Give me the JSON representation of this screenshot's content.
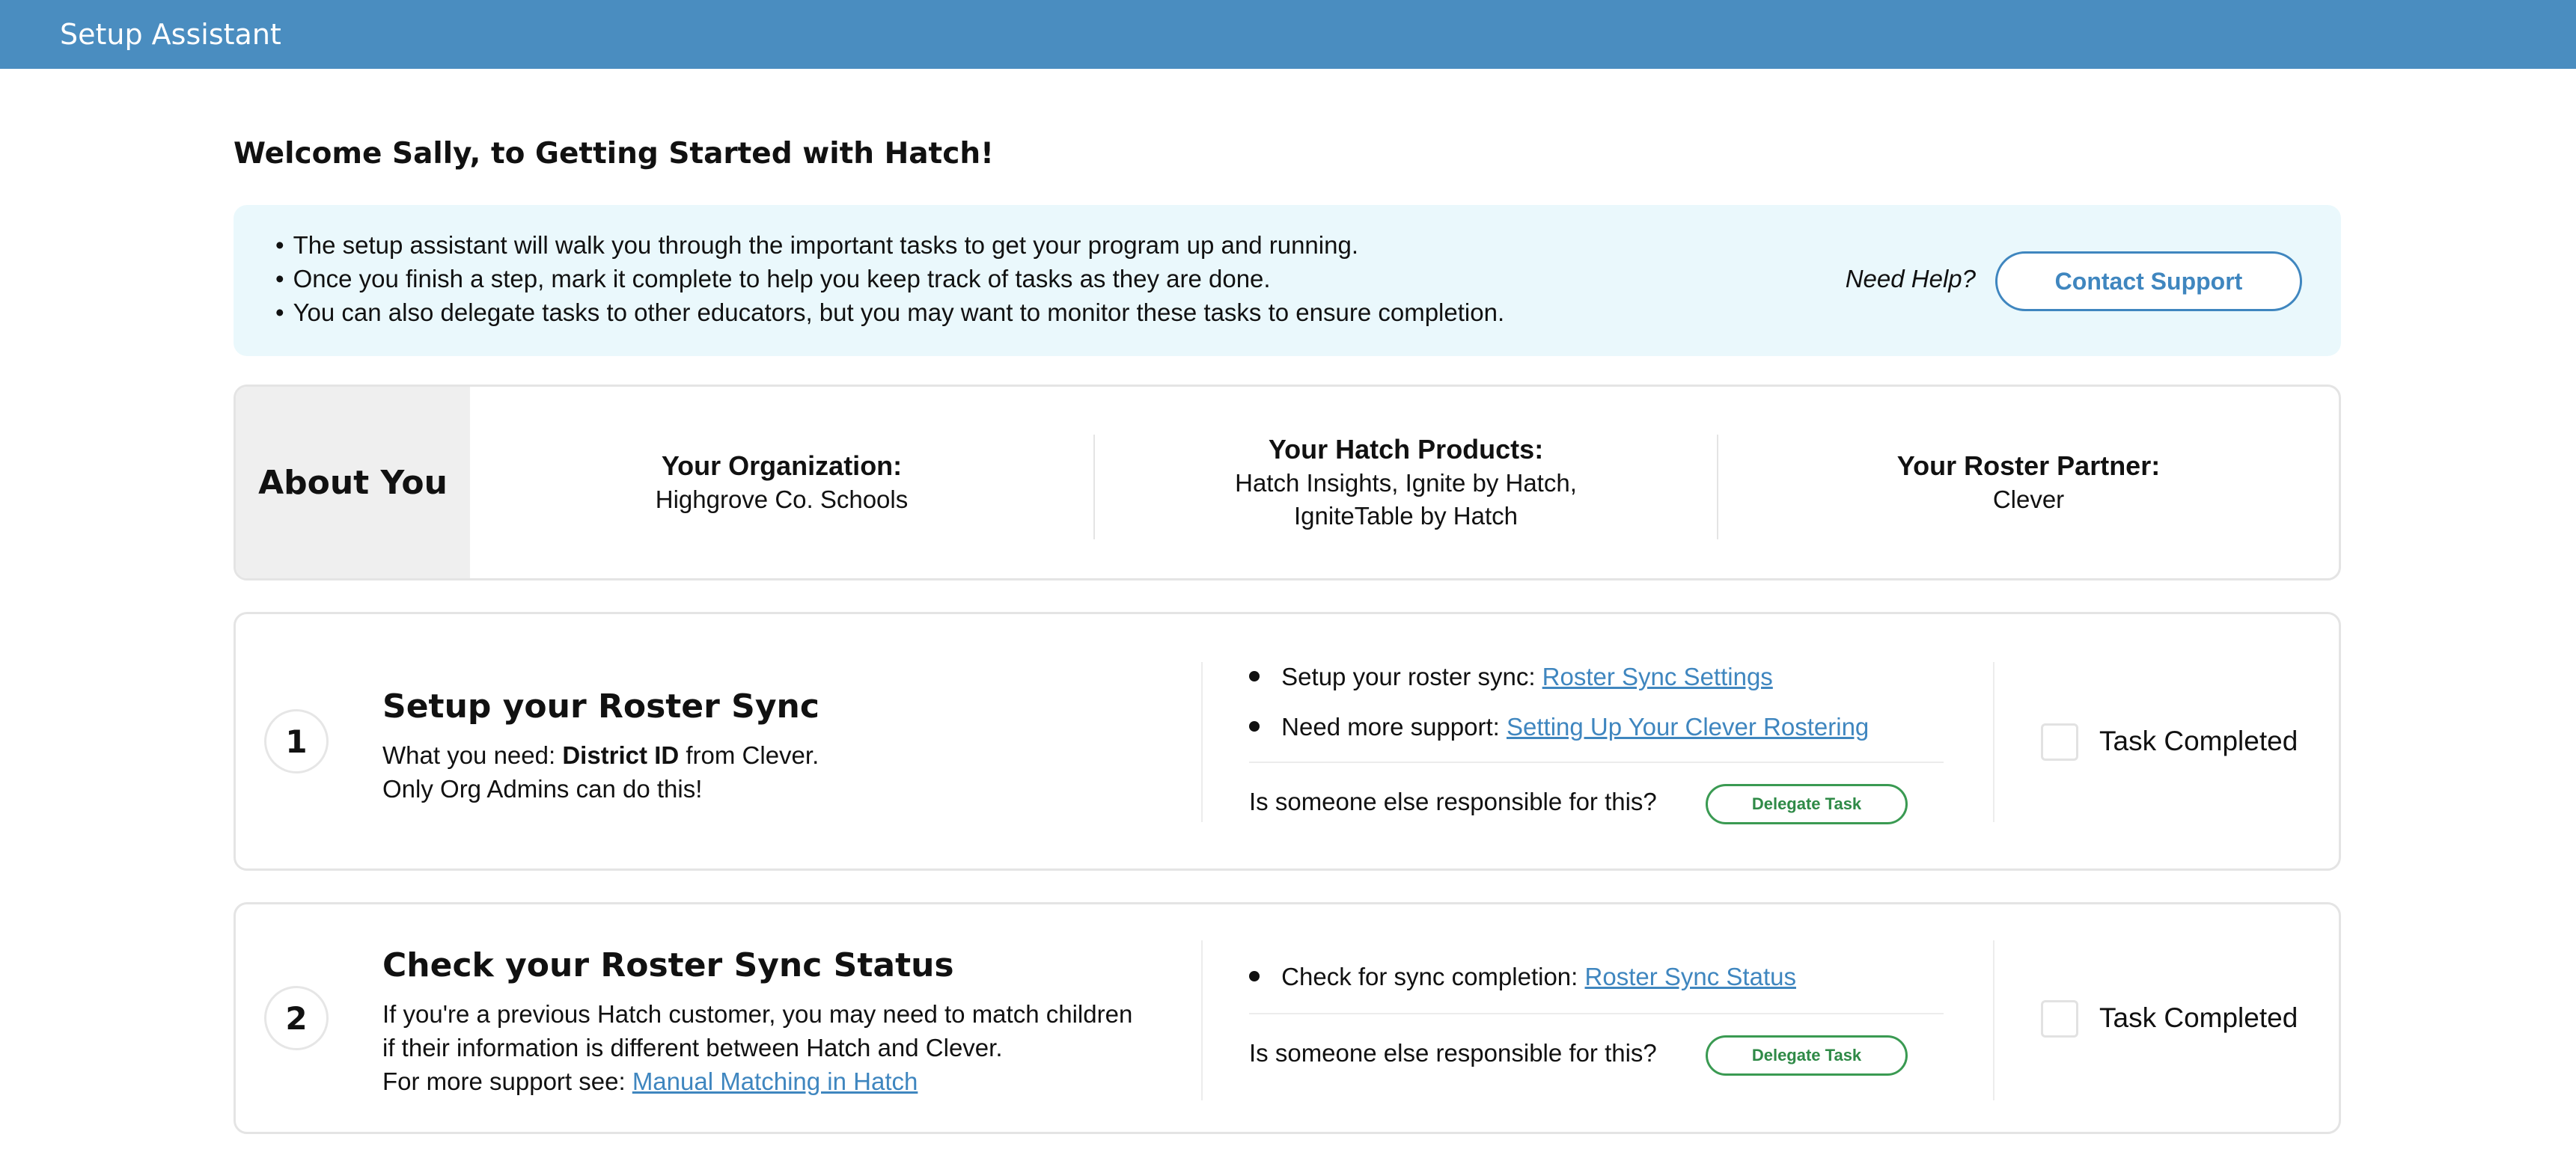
{
  "app": {
    "title": "Setup Assistant"
  },
  "welcome": "Welcome Sally, to Getting Started with Hatch!",
  "info": {
    "bullets": [
      "The setup assistant will walk you through the important tasks to get your program up and running.",
      "Once you finish a step, mark it complete to help you keep track of tasks as they are done.",
      "You can also delegate tasks to other educators, but you may want to monitor these tasks to ensure completion."
    ],
    "need_help": "Need Help?",
    "contact_label": "Contact Support"
  },
  "about": {
    "label": "About You",
    "organization": {
      "heading": "Your Organization:",
      "value": "Highgrove Co. Schools"
    },
    "products": {
      "heading": "Your Hatch Products:",
      "line1": "Hatch Insights, Ignite by Hatch,",
      "line2": "IgniteTable by Hatch"
    },
    "roster_partner": {
      "heading": "Your Roster Partner:",
      "value": "Clever"
    }
  },
  "tasks": [
    {
      "number": "1",
      "title": "Setup your Roster Sync",
      "desc_prefix": "What you need: ",
      "desc_bold": "District ID",
      "desc_suffix": " from Clever.",
      "desc_line2": "Only Org Admins can do this!",
      "bullets": [
        {
          "text": "Setup your roster sync: ",
          "link": "Roster Sync Settings"
        },
        {
          "text": "Need more support: ",
          "link": "Setting Up Your Clever Rostering"
        }
      ],
      "responsible": "Is someone else responsible for this?",
      "delegate_label": "Delegate Task",
      "completed_label": "Task Completed",
      "completed": false
    },
    {
      "number": "2",
      "title": "Check your Roster Sync Status",
      "desc_line1": "If you're a previous Hatch customer, you may need to match children",
      "desc_line2": "if their information is different between Hatch and Clever.",
      "desc_line3_prefix": "For more support see: ",
      "desc_line3_link": "Manual Matching in Hatch",
      "bullets": [
        {
          "text": "Check for sync completion: ",
          "link": "Roster Sync Status"
        }
      ],
      "responsible": "Is someone else responsible for this?",
      "delegate_label": "Delegate Task",
      "completed_label": "Task Completed",
      "completed": false
    }
  ]
}
